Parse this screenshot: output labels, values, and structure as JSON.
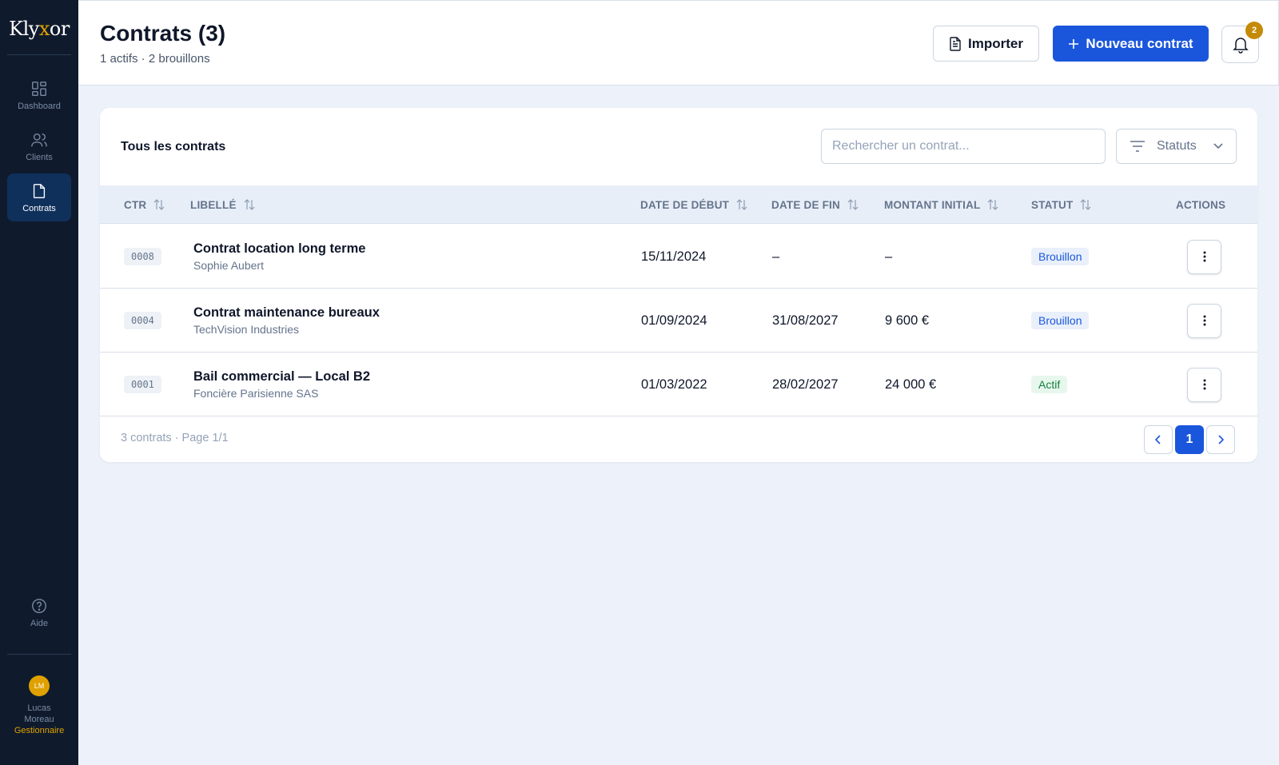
{
  "app": {
    "logo_pre": "Kly",
    "logo_x": "x",
    "logo_post": "or",
    "accent_color": "#1a56db",
    "gold_color": "#e0a100",
    "sidebar_color": "#0f1b2d"
  },
  "sidebar": {
    "items": [
      {
        "label": "Dashboard",
        "icon": "grid-icon"
      },
      {
        "label": "Clients",
        "icon": "users-icon"
      },
      {
        "label": "Contrats",
        "icon": "document-icon",
        "active": true
      }
    ],
    "help_label": "Aide",
    "user": {
      "initials": "LM",
      "first_name": "Lucas",
      "last_name": "Moreau",
      "role": "Gestionnaire"
    }
  },
  "header": {
    "title": "Contrats (3)",
    "subtitle": "1 actifs · 2 brouillons",
    "import_label": "Importer",
    "new_label": "Nouveau contrat",
    "notification_count": "2"
  },
  "card": {
    "title": "Tous les contrats",
    "search_placeholder": "Rechercher un contrat...",
    "status_filter_label": "Statuts"
  },
  "table": {
    "columns": {
      "ctr": "CTR",
      "libelle": "LIBELLÉ",
      "date_debut": "DATE DE DÉBUT",
      "date_fin": "DATE DE FIN",
      "montant": "MONTANT INITIAL",
      "statut": "STATUT",
      "actions": "ACTIONS"
    },
    "rows": [
      {
        "code": "0008",
        "title": "Contrat location long terme",
        "client": "Sophie Aubert",
        "start": "15/11/2024",
        "end": "–",
        "amount": "–",
        "status": "Brouillon"
      },
      {
        "code": "0004",
        "title": "Contrat maintenance bureaux",
        "client": "TechVision Industries",
        "start": "01/09/2024",
        "end": "31/08/2027",
        "amount": "9 600 €",
        "status": "Brouillon"
      },
      {
        "code": "0001",
        "title": "Bail commercial — Local B2",
        "client": "Foncière Parisienne SAS",
        "start": "01/03/2022",
        "end": "28/02/2027",
        "amount": "24 000 €",
        "status": "Actif"
      }
    ]
  },
  "pagination": {
    "summary": "3 contrats · Page 1/1",
    "current_page": "1"
  }
}
